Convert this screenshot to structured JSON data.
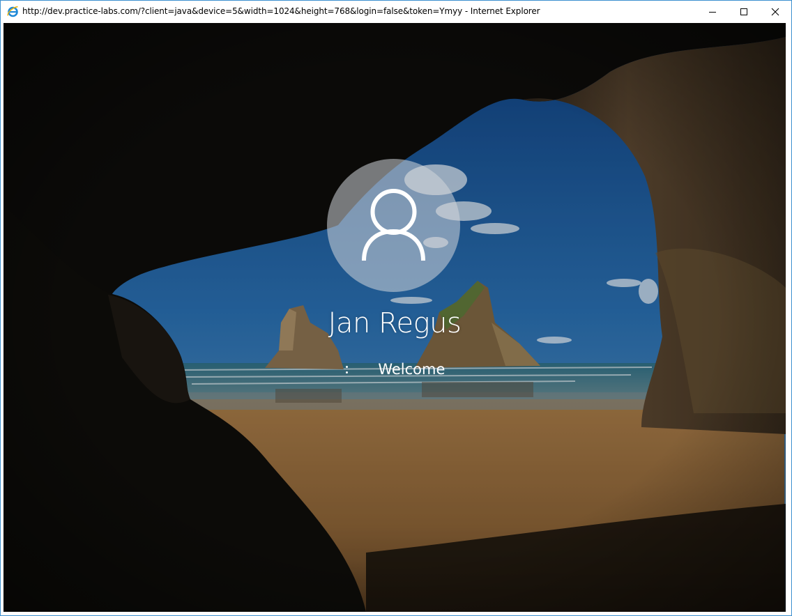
{
  "window": {
    "title": "http://dev.practice-labs.com/?client=java&device=5&width=1024&height=768&login=false&token=Ymyy - Internet Explorer",
    "controls": {
      "minimize": "minimize-icon",
      "maximize": "maximize-icon",
      "close": "close-icon"
    }
  },
  "lock_screen": {
    "user_name": "Jan Regus",
    "status": "Welcome",
    "avatar_icon": "user-icon",
    "spinner_icon": "loading-spinner-icon"
  },
  "colors": {
    "window_border": "#3b8fcf",
    "sky": "#1f5fa0",
    "sand": "#9a6f3c"
  }
}
